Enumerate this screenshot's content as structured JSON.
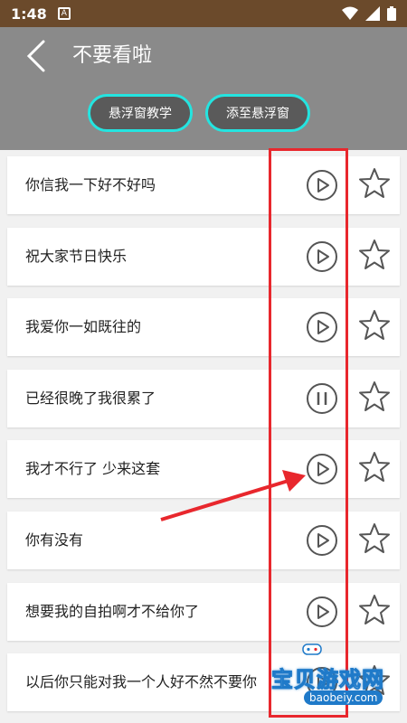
{
  "status": {
    "time": "1:48",
    "notif_letter": "A"
  },
  "header": {
    "title": "不要看啦",
    "btn_tutorial": "悬浮窗教学",
    "btn_add_float": "添至悬浮窗"
  },
  "items": [
    {
      "text": "你信我一下好不好吗",
      "state": "play"
    },
    {
      "text": "祝大家节日快乐",
      "state": "play"
    },
    {
      "text": "我爱你一如既往的",
      "state": "play"
    },
    {
      "text": "已经很晚了我很累了",
      "state": "pause"
    },
    {
      "text": "我才不行了 少来这套",
      "state": "play"
    },
    {
      "text": "你有没有",
      "state": "play"
    },
    {
      "text": "想要我的自拍啊才不给你了",
      "state": "play"
    },
    {
      "text": "以后你只能对我一个人好不然不要你",
      "state": "play"
    }
  ],
  "watermark": {
    "text": "宝贝游戏网",
    "url": "baobeiy.com"
  },
  "colors": {
    "status": "#6b4a2b",
    "header": "#8a8a8a",
    "accent": "#24e4e0",
    "highlight": "#e8272d"
  }
}
